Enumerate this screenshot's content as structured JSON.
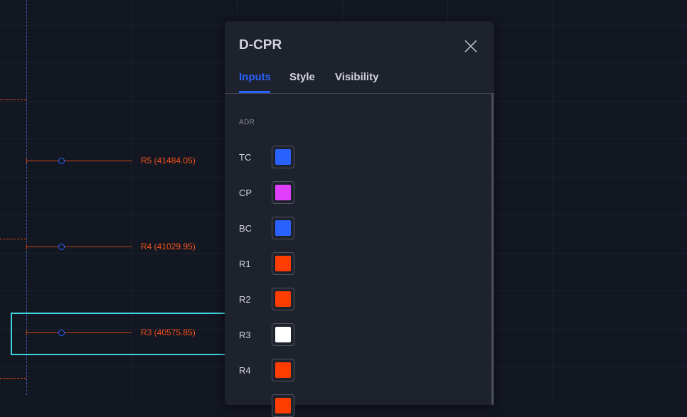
{
  "chart": {
    "levels": [
      {
        "label": "R5 (41484.05)"
      },
      {
        "label": "R4 (41029.95)"
      },
      {
        "label": "R3 (40575.85)"
      }
    ]
  },
  "dialog": {
    "title": "D-CPR",
    "tabs": [
      {
        "label": "Inputs",
        "active": true
      },
      {
        "label": "Style",
        "active": false
      },
      {
        "label": "Visibility",
        "active": false
      }
    ],
    "section_label": "ADR",
    "inputs": [
      {
        "label": "TC",
        "color": "#2962ff"
      },
      {
        "label": "CP",
        "color": "#e040fb"
      },
      {
        "label": "BC",
        "color": "#2962ff"
      },
      {
        "label": "R1",
        "color": "#ff3d00"
      },
      {
        "label": "R2",
        "color": "#ff3d00"
      },
      {
        "label": "R3",
        "color": "#ffffff"
      },
      {
        "label": "R4",
        "color": "#ff3d00"
      },
      {
        "label": "",
        "color": "#ff3d00"
      }
    ]
  },
  "colors": {
    "background": "#131722",
    "panel": "#1e222d",
    "accent": "#2962ff",
    "level_line": "#ff3d00",
    "highlight": "#40d4e0"
  }
}
